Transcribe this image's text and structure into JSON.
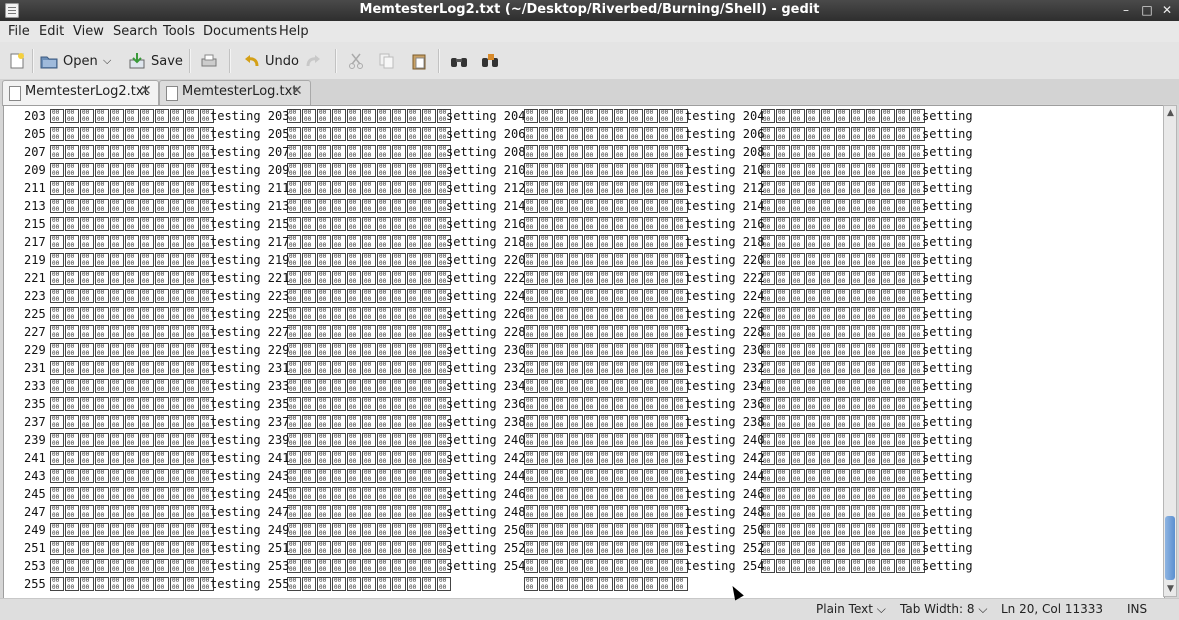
{
  "window": {
    "title": "MemtesterLog2.txt (~/Desktop/Riverbed/Burning/Shell) - gedit",
    "minimize": "–",
    "maximize": "□",
    "close": "✕"
  },
  "menu": [
    "File",
    "Edit",
    "View",
    "Search",
    "Tools",
    "Documents",
    "Help"
  ],
  "toolbar": {
    "open_label": "Open",
    "save_label": "Save",
    "undo_label": "Undo"
  },
  "tabs": [
    {
      "label": "MemtesterLog2.txt",
      "active": true
    },
    {
      "label": "MemtesterLog.txt",
      "active": false
    }
  ],
  "editor": {
    "rows": [
      [
        "203",
        "testing 203",
        "setting 204",
        "testing 204",
        "setting"
      ],
      [
        "205",
        "testing 205",
        "setting 206",
        "testing 206",
        "setting"
      ],
      [
        "207",
        "testing 207",
        "setting 208",
        "testing 208",
        "setting"
      ],
      [
        "209",
        "testing 209",
        "setting 210",
        "testing 210",
        "setting"
      ],
      [
        "211",
        "testing 211",
        "setting 212",
        "testing 212",
        "setting"
      ],
      [
        "213",
        "testing 213",
        "setting 214",
        "testing 214",
        "setting"
      ],
      [
        "215",
        "testing 215",
        "setting 216",
        "testing 216",
        "setting"
      ],
      [
        "217",
        "testing 217",
        "setting 218",
        "testing 218",
        "setting"
      ],
      [
        "219",
        "testing 219",
        "setting 220",
        "testing 220",
        "setting"
      ],
      [
        "221",
        "testing 221",
        "setting 222",
        "testing 222",
        "setting"
      ],
      [
        "223",
        "testing 223",
        "setting 224",
        "testing 224",
        "setting"
      ],
      [
        "225",
        "testing 225",
        "setting 226",
        "testing 226",
        "setting"
      ],
      [
        "227",
        "testing 227",
        "setting 228",
        "testing 228",
        "setting"
      ],
      [
        "229",
        "testing 229",
        "setting 230",
        "testing 230",
        "setting"
      ],
      [
        "231",
        "testing 231",
        "setting 232",
        "testing 232",
        "setting"
      ],
      [
        "233",
        "testing 233",
        "setting 234",
        "testing 234",
        "setting"
      ],
      [
        "235",
        "testing 235",
        "setting 236",
        "testing 236",
        "setting"
      ],
      [
        "237",
        "testing 237",
        "setting 238",
        "testing 238",
        "setting"
      ],
      [
        "239",
        "testing 239",
        "setting 240",
        "testing 240",
        "setting"
      ],
      [
        "241",
        "testing 241",
        "setting 242",
        "testing 242",
        "setting"
      ],
      [
        "243",
        "testing 243",
        "setting 244",
        "testing 244",
        "setting"
      ],
      [
        "245",
        "testing 245",
        "setting 246",
        "testing 246",
        "setting"
      ],
      [
        "247",
        "testing 247",
        "setting 248",
        "testing 248",
        "setting"
      ],
      [
        "249",
        "testing 249",
        "setting 250",
        "testing 250",
        "setting"
      ],
      [
        "251",
        "testing 251",
        "setting 252",
        "testing 252",
        "setting"
      ],
      [
        "253",
        "testing 253",
        "setting 254",
        "testing 254",
        "setting"
      ],
      [
        "255",
        "testing 255",
        "",
        "",
        ""
      ]
    ]
  },
  "status": {
    "language": "Plain Text",
    "tab_width": "Tab Width:  8",
    "position": "Ln 20, Col 11333",
    "mode": "INS"
  }
}
